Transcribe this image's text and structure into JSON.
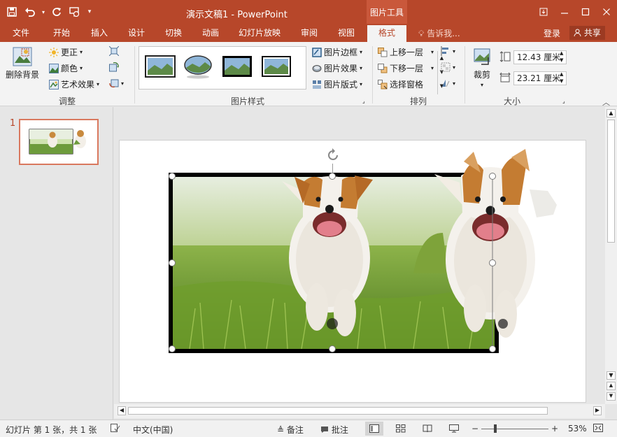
{
  "titlebar": {
    "doc_title": "演示文稿1 - PowerPoint",
    "context_tab_header": "图片工具",
    "bg_color": "#b7472a"
  },
  "qat": {
    "icons": [
      "save-icon",
      "undo-icon",
      "redo-icon",
      "start-from-beginning-icon",
      "customize-qat-icon"
    ]
  },
  "tabs": {
    "file": "文件",
    "home": "开始",
    "insert": "插入",
    "design": "设计",
    "transitions": "切换",
    "animations": "动画",
    "slideshow": "幻灯片放映",
    "review": "审阅",
    "view": "视图",
    "format": "格式",
    "tell_me": "告诉我...",
    "login": "登录",
    "share": "共享"
  },
  "ribbon": {
    "adjust": {
      "label": "调整",
      "remove_bg": "删除背景",
      "corrections": "更正",
      "color": "颜色",
      "artistic": "艺术效果"
    },
    "styles": {
      "label": "图片样式",
      "border": "图片边框",
      "effects": "图片效果",
      "layout": "图片版式"
    },
    "arrange": {
      "label": "排列",
      "bring_forward": "上移一层",
      "send_backward": "下移一层",
      "selection_pane": "选择窗格"
    },
    "size": {
      "label": "大小",
      "crop": "裁剪",
      "height": "12.43 厘米",
      "width": "23.21 厘米"
    }
  },
  "thumbnails": {
    "slide_number": "1"
  },
  "statusbar": {
    "slide_info": "幻灯片 第 1 张，共 1 张",
    "language": "中文(中国)",
    "notes": "备注",
    "comments": "批注",
    "zoom": "53%"
  },
  "colors": {
    "accent": "#b7472a",
    "selection": "#d9785e"
  }
}
